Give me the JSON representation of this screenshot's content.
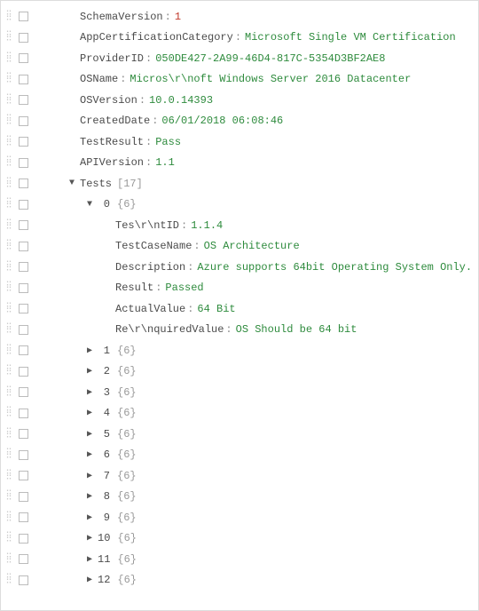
{
  "root": {
    "SchemaVersion": {
      "key": "SchemaVersion",
      "value": "1",
      "kind": "num"
    },
    "AppCertificationCategory": {
      "key": "AppCertificationCategory",
      "value": "Microsoft Single VM Certification",
      "kind": "str"
    },
    "ProviderID": {
      "key": "ProviderID",
      "value": "050DE427-2A99-46D4-817C-5354D3BF2AE8",
      "kind": "str"
    },
    "OSName": {
      "key": "OSName",
      "value": "Micros\\r\\noft Windows Server 2016 Datacenter",
      "kind": "str"
    },
    "OSVersion": {
      "key": "OSVersion",
      "value": "10.0.14393",
      "kind": "str"
    },
    "CreatedDate": {
      "key": "CreatedDate",
      "value": "06/01/2018 06:08:46",
      "kind": "str"
    },
    "TestResult": {
      "key": "TestResult",
      "value": "Pass",
      "kind": "str"
    },
    "APIVersion": {
      "key": "APIVersion",
      "value": "1.1",
      "kind": "str"
    }
  },
  "tests": {
    "label": "Tests",
    "count": "[17]",
    "first": {
      "index": "0",
      "summary": "{6}",
      "fields": {
        "TestID": {
          "key": "Tes\\r\\ntID",
          "value": "1.1.4"
        },
        "TestCaseName": {
          "key": "TestCaseName",
          "value": "OS Architecture"
        },
        "Description": {
          "key": "Description",
          "value": "Azure supports 64bit Operating System Only."
        },
        "Result": {
          "key": "Result",
          "value": "Passed"
        },
        "ActualValue": {
          "key": "ActualValue",
          "value": "64 Bit"
        },
        "RequiredValue": {
          "key": "Re\\r\\nquiredValue",
          "value": "OS Should be 64 bit"
        }
      }
    },
    "rest": [
      {
        "index": "1",
        "summary": "{6}"
      },
      {
        "index": "2",
        "summary": "{6}"
      },
      {
        "index": "3",
        "summary": "{6}"
      },
      {
        "index": "4",
        "summary": "{6}"
      },
      {
        "index": "5",
        "summary": "{6}"
      },
      {
        "index": "6",
        "summary": "{6}"
      },
      {
        "index": "7",
        "summary": "{6}"
      },
      {
        "index": "8",
        "summary": "{6}"
      },
      {
        "index": "9",
        "summary": "{6}"
      },
      {
        "index": "10",
        "summary": "{6}"
      },
      {
        "index": "11",
        "summary": "{6}"
      },
      {
        "index": "12",
        "summary": "{6}"
      }
    ]
  }
}
